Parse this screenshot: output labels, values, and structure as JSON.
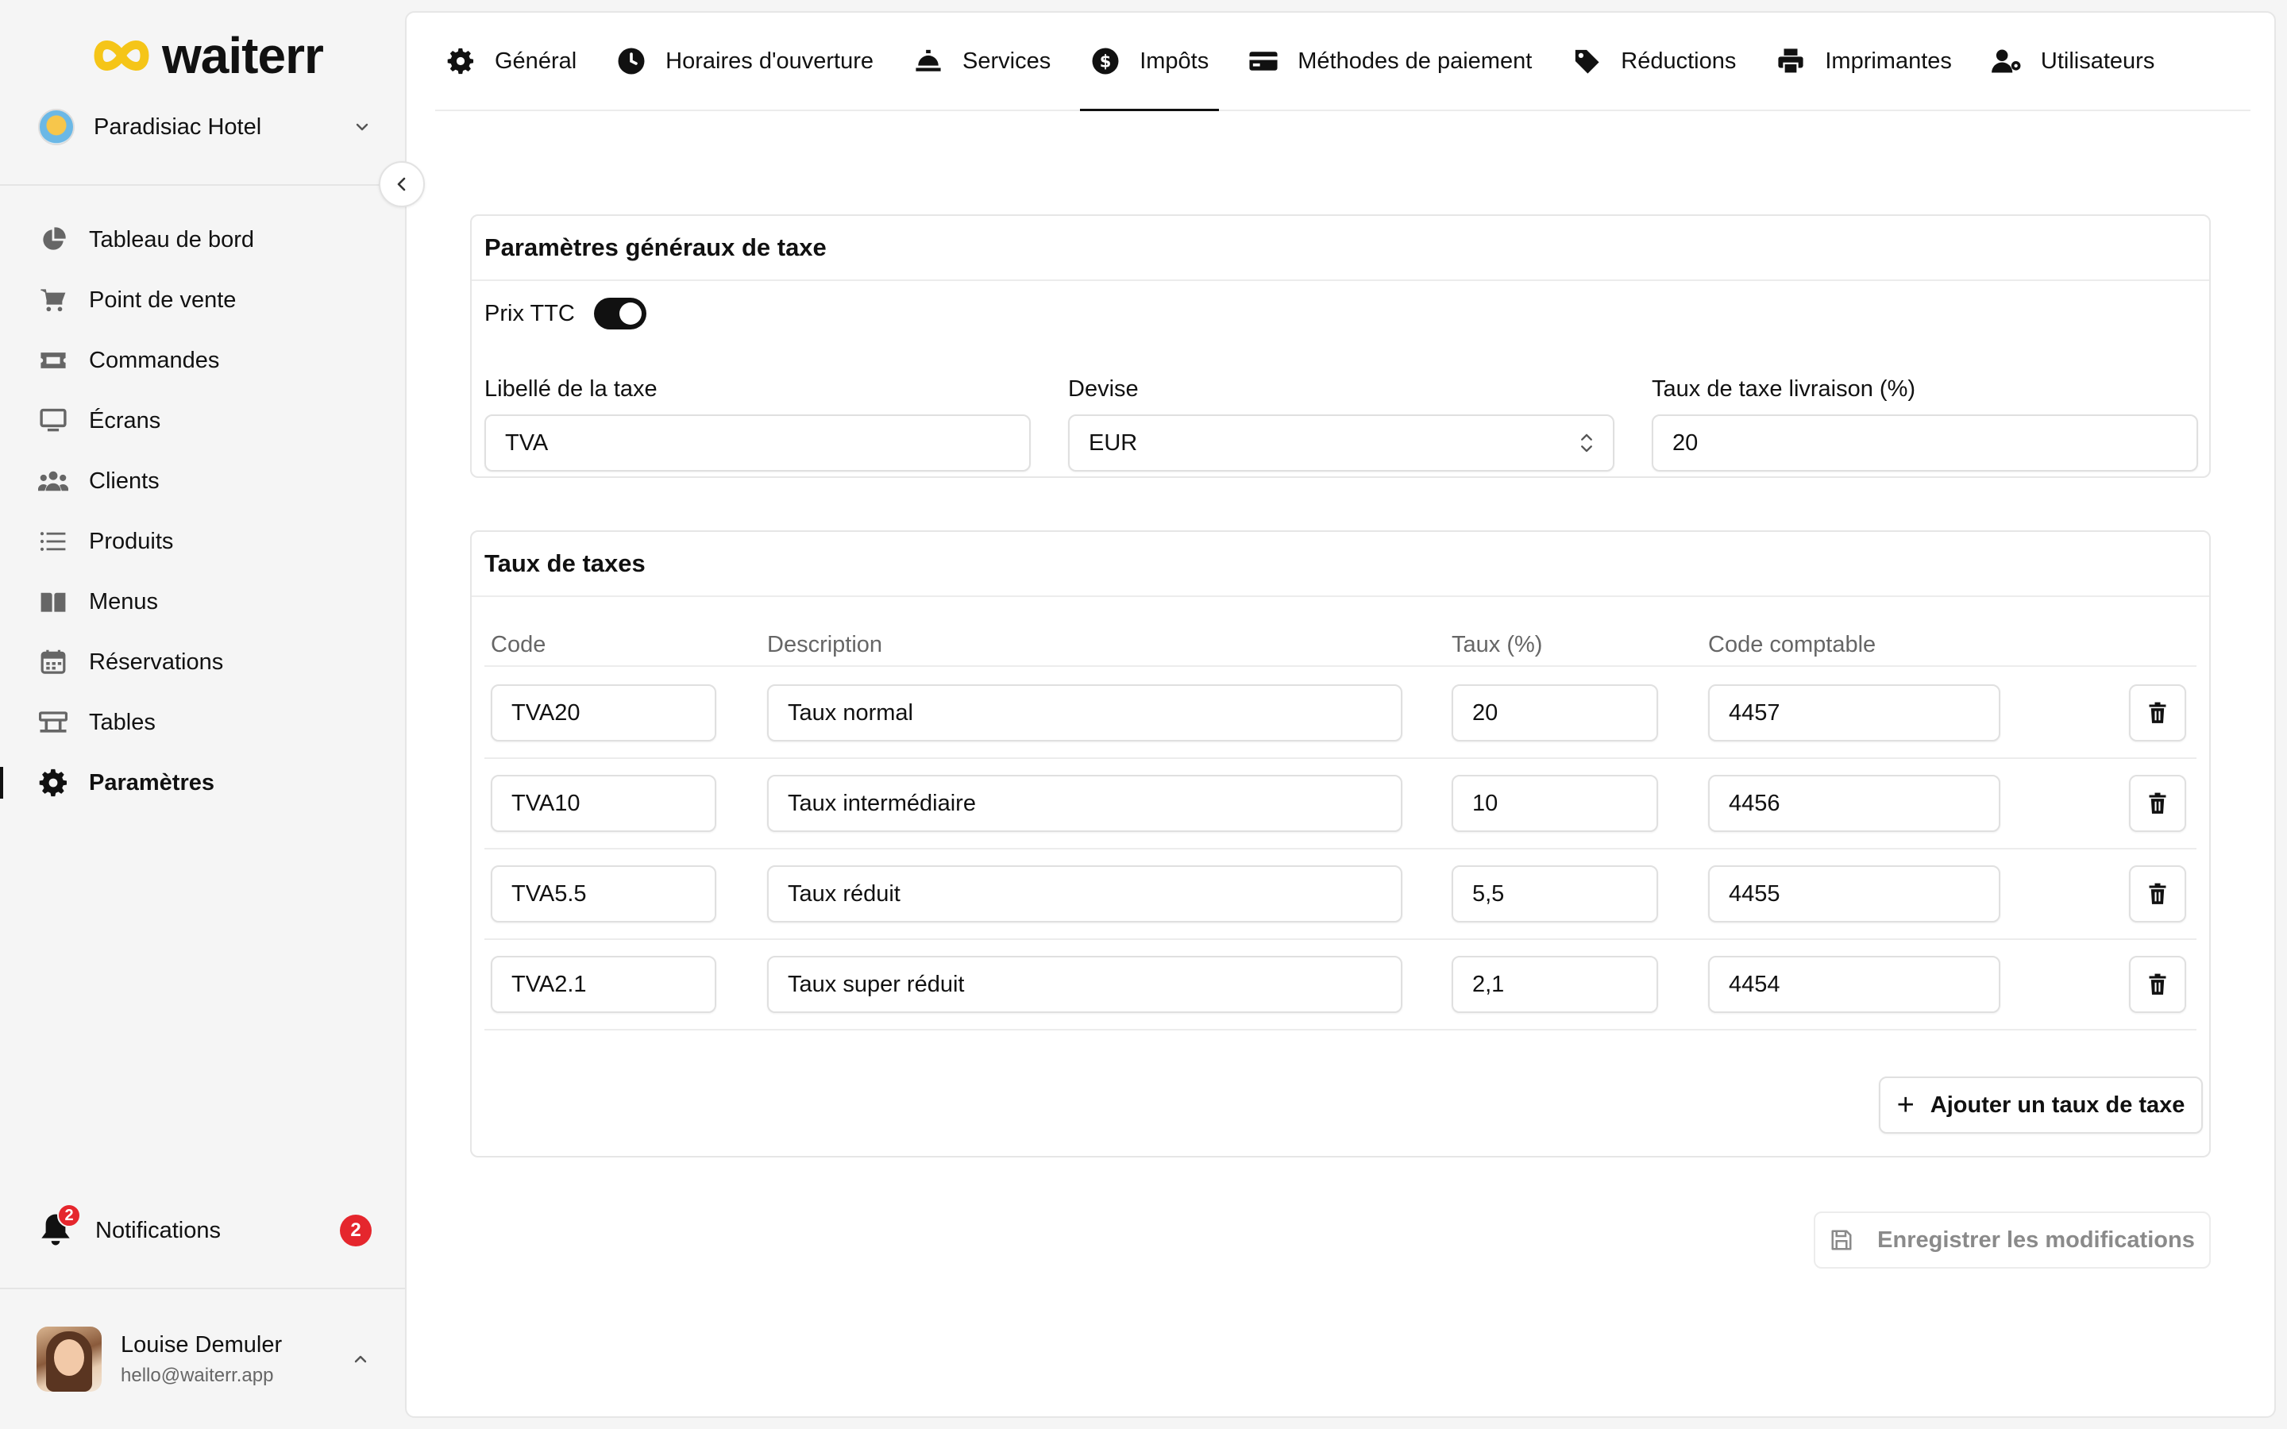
{
  "brand": {
    "name": "waiterr",
    "accent": "#F5C518"
  },
  "hotel": {
    "name": "Paradisiac Hotel"
  },
  "nav": [
    {
      "label": "Tableau de bord",
      "icon": "pie-chart-icon"
    },
    {
      "label": "Point de vente",
      "icon": "cart-icon"
    },
    {
      "label": "Commandes",
      "icon": "ticket-icon"
    },
    {
      "label": "Écrans",
      "icon": "monitor-icon"
    },
    {
      "label": "Clients",
      "icon": "users-icon"
    },
    {
      "label": "Produits",
      "icon": "list-icon"
    },
    {
      "label": "Menus",
      "icon": "book-icon"
    },
    {
      "label": "Réservations",
      "icon": "calendar-icon"
    },
    {
      "label": "Tables",
      "icon": "table-icon"
    },
    {
      "label": "Paramètres",
      "icon": "gear-icon",
      "active": true
    }
  ],
  "notifications": {
    "label": "Notifications",
    "count": "2"
  },
  "user": {
    "name": "Louise Demuler",
    "email": "hello@waiterr.app"
  },
  "tabs": [
    {
      "label": "Général",
      "icon": "gear-icon"
    },
    {
      "label": "Horaires d'ouverture",
      "icon": "clock-icon"
    },
    {
      "label": "Services",
      "icon": "cloche-icon"
    },
    {
      "label": "Impôts",
      "icon": "dollar-circle-icon",
      "active": true
    },
    {
      "label": "Méthodes de paiement",
      "icon": "credit-card-icon"
    },
    {
      "label": "Réductions",
      "icon": "tag-icon"
    },
    {
      "label": "Imprimantes",
      "icon": "printer-icon"
    },
    {
      "label": "Utilisateurs",
      "icon": "user-cog-icon"
    }
  ],
  "general_tax": {
    "title": "Paramètres généraux de taxe",
    "prix_ttc_label": "Prix TTC",
    "prix_ttc_on": true,
    "label_field": {
      "label": "Libellé de la taxe",
      "value": "TVA"
    },
    "currency_field": {
      "label": "Devise",
      "value": "EUR"
    },
    "delivery_field": {
      "label": "Taux de taxe livraison (%)",
      "value": "20"
    }
  },
  "tax_rates": {
    "title": "Taux de taxes",
    "columns": {
      "code": "Code",
      "description": "Description",
      "rate": "Taux (%)",
      "account": "Code comptable"
    },
    "rows": [
      {
        "code": "TVA20",
        "description": "Taux normal",
        "rate": "20",
        "account": "4457"
      },
      {
        "code": "TVA10",
        "description": "Taux intermédiaire",
        "rate": "10",
        "account": "4456"
      },
      {
        "code": "TVA5.5",
        "description": "Taux réduit",
        "rate": "5,5",
        "account": "4455"
      },
      {
        "code": "TVA2.1",
        "description": "Taux super réduit",
        "rate": "2,1",
        "account": "4454"
      }
    ],
    "add_label": "Ajouter un taux de taxe"
  },
  "save_label": "Enregistrer les modifications"
}
